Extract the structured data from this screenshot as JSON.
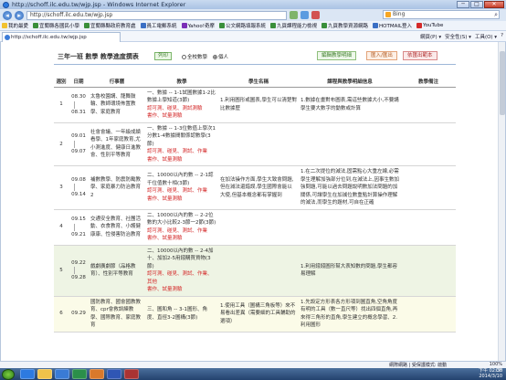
{
  "window": {
    "title": "http://schoff.ilc.edu.tw/wjp.jsp - Windows Internet Explorer",
    "min": "─",
    "max": "□",
    "close": "✕"
  },
  "address": {
    "url": "http://schoff.ilc.edu.tw/wjp.jsp",
    "search_placeholder": "Bing"
  },
  "favorites": [
    {
      "label": "我的最愛",
      "color": "#f2c230"
    },
    {
      "label": "宜蘭縣各國民小學",
      "color": "#3a8f3a"
    },
    {
      "label": "宜蘭縣縣政府教育處",
      "color": "#3a8f3a"
    },
    {
      "label": "員工電郵系統",
      "color": "#3b6fc4"
    },
    {
      "label": "Yahoo!奇摩",
      "color": "#7b2fb6"
    },
    {
      "label": "公文網路填報系統",
      "color": "#3a8f3a"
    },
    {
      "label": "九頁課程能力檢視",
      "color": "#3a8f3a"
    },
    {
      "label": "九頁教學資源網路",
      "color": "#3a8f3a"
    },
    {
      "label": "HOTMAIL登入",
      "color": "#3b6fc4"
    },
    {
      "label": "YouTube",
      "color": "#d42a2a"
    }
  ],
  "tab": {
    "label": "http://schoff.ilc.edu.tw/wjp.jsp"
  },
  "commands": [
    "網頁(P) ▾",
    "安全性(S) ▾",
    "工具(O) ▾",
    "?"
  ],
  "page": {
    "title": "三年一班 數學 教學進度撰表",
    "print": "列印",
    "radio_all": "全校數學",
    "radio_personal": "個人",
    "btn_edit": "編輯教學明細",
    "btn_import": "匯入/匯出",
    "btn_export": "依匯出範本"
  },
  "table": {
    "headers": [
      "週別",
      "日期",
      "行事曆",
      "教學",
      "學生名稱",
      "課程與教學明細信息",
      "教學備注"
    ],
    "rows": [
      {
        "week": "1",
        "date_from": "08.30",
        "date_to": "08.31",
        "events": "太魯校園講、龍舞鼓輪、教師環境佈置教學、家庭教育",
        "teaching": "一、數據 -- 1-1試圖數據1-2比數據上學知道(3節)",
        "warn": "認可測、碰見、測試測驗",
        "warn2": "書作、試量測驗",
        "student": "1.利用圖形或圖表,學生可以清楚對比數據歷",
        "detail": "1.數據在畫對布圖表,需這些數據大小,不要講學生要大數字的動數或計算",
        "note": ""
      },
      {
        "week": "2",
        "date_from": "09.01",
        "date_to": "09.07",
        "events": "社會會議、一年級成績看學、1年家庭教育,尤小測進度、健康日進教會、性別平等教育",
        "teaching": "一、數據 -- 1-3位數值上學次1分數1-4數據間關係認數學(3節)",
        "warn": "認可測、碰見、測試、作業",
        "warn2": "書作、試量測驗",
        "student": "",
        "detail": "",
        "note": ""
      },
      {
        "week": "3",
        "date_from": "09.08",
        "date_to": "09.14",
        "events": "補數教學、防震防颱教學、家庭暴力防治教育2",
        "teaching": "二、10000以內的數 -- 2-1認千位值數十相(3節)",
        "warn": "認可測、碰見、測試、作業",
        "warn2": "書作、試量測驗",
        "student": "在加法操作方面,學生大致會問題,但在減法還錯誤,學生國際會能以大使,但基本概念都有掌握到",
        "detail": "1.在二次提位的減法,固需點心大重左線,必需學生理解加強部分位到,在減法上,因事生數加強問題,可能以過去問題說明數加法問題的加關係,可讓學生在加減位數重點計算操作理解的減法,而學生的題材,可自在正確",
        "note": ""
      },
      {
        "week": "4",
        "date_from": "09.15",
        "date_to": "09.21",
        "events": "交通安全教育、社團活動、衣食教育、小護健康康、性侵害防治教育",
        "teaching": "二、10000以內的數 -- 2-2位數的大小比較2-3節一2節(3節)",
        "warn": "認可測、碰見、測試、作業",
        "warn2": "書作、試量測驗",
        "student": "",
        "detail": "",
        "note": ""
      },
      {
        "week": "5",
        "date_from": "09.22",
        "date_to": "09.28",
        "events": "戲劇廣劇節（品格教育）、性別平等教育",
        "teaching": "二、10000以內的數 -- 2-4加十、加加2-5用錢購買貨物(3節)",
        "warn": "認可測、碰見、測試、作業、其他",
        "warn2": "書作、試量測驗",
        "student": "",
        "detail": "1.利用錢錢圖形幫大表知數的問題,學生都容易理解",
        "note": ""
      },
      {
        "week": "6",
        "date_from": "09.29",
        "date_to": "",
        "events": "國防教育、國會國教教育、cpr會救訓練教學、國際教育、家庭教育",
        "teaching": "三、圖和角 -- 3-1圖形、角度、直徑3-2圖構(3節)",
        "warn": "",
        "warn2": "",
        "student": "1.使用工具（圖構三角板等）來不易看出差異（需要細的工具輔助的選項）",
        "detail": "1.先設定方形表各方形項到圖直角,空角角度有明的工具（數一直尺等）找出四個直角,再來得三角形的直角,學生建立的概念學習、2.利用圖形",
        "note": ""
      }
    ]
  },
  "status": {
    "zone": "網際網路 | 受保護模式: 啟動",
    "zoom": "100%"
  },
  "taskbar": {
    "lang": "CH",
    "time": "下午 02:30",
    "date": "2014/3/10"
  }
}
